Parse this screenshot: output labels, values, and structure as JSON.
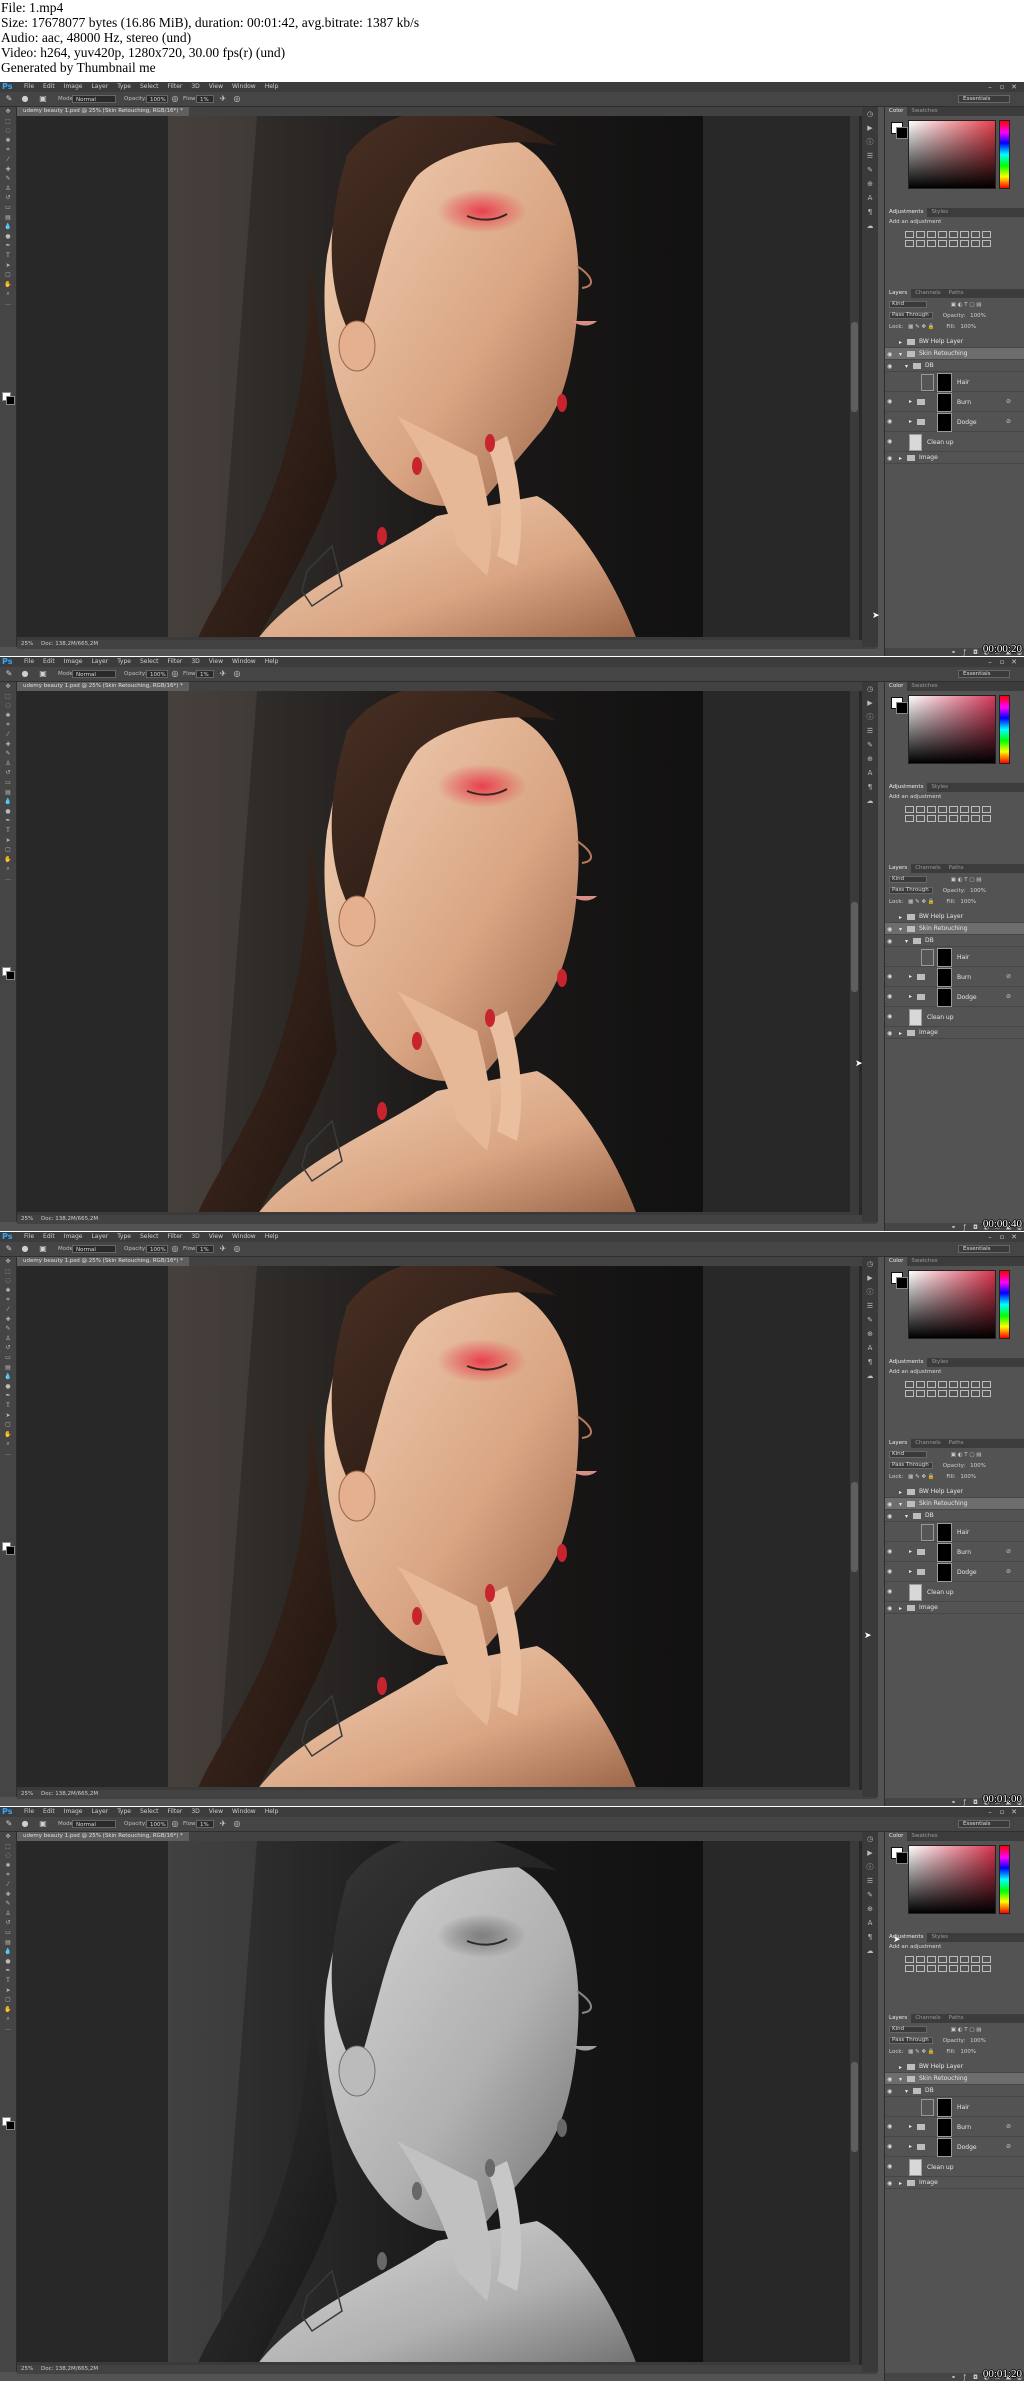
{
  "info": {
    "file": "File: 1.mp4",
    "size": "Size: 17678077 bytes (16.86 MiB), duration: 00:01:42, avg.bitrate: 1387 kb/s",
    "audio": "Audio: aac, 48000 Hz, stereo (und)",
    "video": "Video: h264, yuv420p, 1280x720, 30.00 fps(r) (und)",
    "generator": "Generated by Thumbnail me"
  },
  "ps": {
    "logo": "Ps",
    "menus": [
      "File",
      "Edit",
      "Image",
      "Layer",
      "Type",
      "Select",
      "Filter",
      "3D",
      "View",
      "Window",
      "Help"
    ],
    "options": {
      "mode_label": "Mode:",
      "mode_value": "Normal",
      "opacity_label": "Opacity:",
      "opacity_value": "100%",
      "flow_label": "Flow:",
      "flow_value": "1%",
      "workspace": "Essentials"
    },
    "doc_tab": "udemy beauty 1.psd @ 25% (Skin Retouching, RGB/16*) *",
    "status_zoom": "25%",
    "status_doc": "Doc: 138,2M/665,2M",
    "color_tabs": [
      "Color",
      "Swatches"
    ],
    "adjust_tabs": [
      "Adjustments",
      "Styles"
    ],
    "adjust_title": "Add an adjustment",
    "layer_tabs": [
      "Layers",
      "Channels",
      "Paths"
    ],
    "kind_label": "Kind",
    "blend_mode": "Pass Through",
    "opacity_label": "Opacity:",
    "opacity_value": "100%",
    "lock_label": "Lock:",
    "fill_label": "Fill:",
    "fill_value": "100%",
    "layers": [
      {
        "name": "BW Help Layer"
      },
      {
        "name": "Skin Retouching"
      },
      {
        "name": "DB"
      },
      {
        "name": "Hair"
      },
      {
        "name": "Burn"
      },
      {
        "name": "Dodge"
      },
      {
        "name": "Clean up"
      },
      {
        "name": "Image"
      }
    ]
  },
  "frames": [
    {
      "timestamp": "00:00:20",
      "grayscale": false
    },
    {
      "timestamp": "00:00:40",
      "grayscale": false
    },
    {
      "timestamp": "00:01:00",
      "grayscale": false
    },
    {
      "timestamp": "00:01:20",
      "grayscale": true
    }
  ]
}
